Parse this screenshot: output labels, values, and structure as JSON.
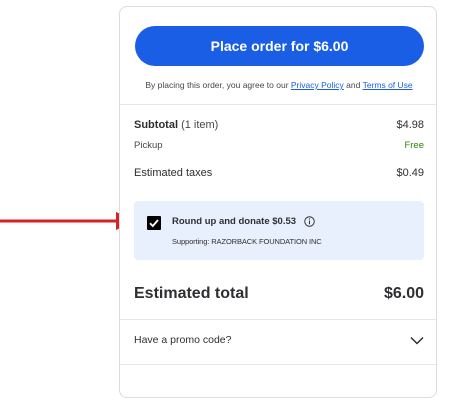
{
  "checkout": {
    "place_order_label": "Place order for $6.00",
    "legal": {
      "prefix": "By placing this order, you agree to our ",
      "privacy_link": "Privacy Policy",
      "conjunction": " and ",
      "terms_link": "Terms of Use"
    },
    "summary": {
      "subtotal_label": "Subtotal",
      "subtotal_count": "(1 item)",
      "subtotal_value": "$4.98",
      "pickup_label": "Pickup",
      "pickup_value": "Free",
      "taxes_label": "Estimated taxes",
      "taxes_value": "$0.49"
    },
    "donation": {
      "checked": true,
      "title": "Round up and donate $0.53",
      "supporting": "Supporting: RAZORBACK FOUNDATION INC",
      "info_icon": "info-icon"
    },
    "total": {
      "label": "Estimated total",
      "value": "$6.00"
    },
    "promo": {
      "label": "Have a promo code?",
      "icon": "chevron-down-icon"
    }
  },
  "annotation": {
    "arrow_color": "#d32323",
    "accent_color": "#1a5ee6",
    "free_color": "#2a8703",
    "donation_bg": "#e8f0fd"
  }
}
